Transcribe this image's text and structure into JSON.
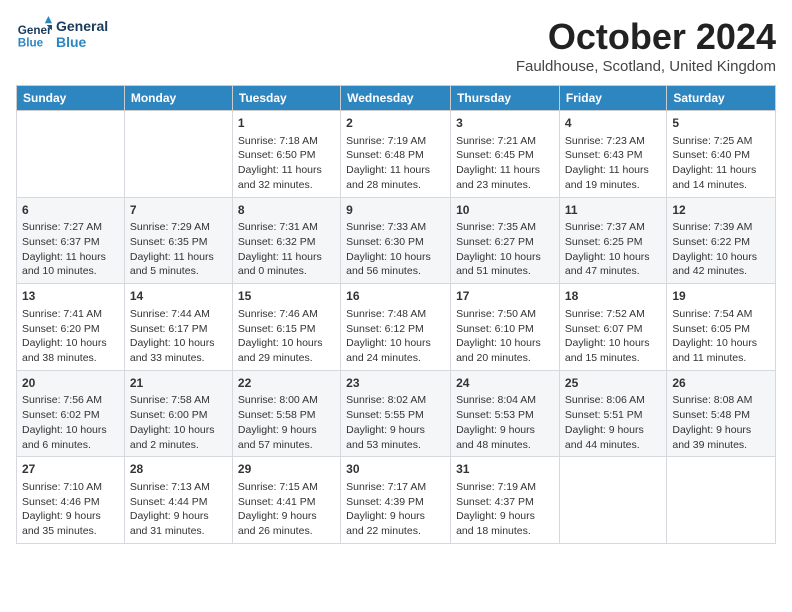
{
  "header": {
    "logo_line1": "General",
    "logo_line2": "Blue",
    "month_title": "October 2024",
    "location": "Fauldhouse, Scotland, United Kingdom"
  },
  "weekdays": [
    "Sunday",
    "Monday",
    "Tuesday",
    "Wednesday",
    "Thursday",
    "Friday",
    "Saturday"
  ],
  "weeks": [
    [
      {
        "day": "",
        "content": ""
      },
      {
        "day": "",
        "content": ""
      },
      {
        "day": "1",
        "content": "Sunrise: 7:18 AM\nSunset: 6:50 PM\nDaylight: 11 hours\nand 32 minutes."
      },
      {
        "day": "2",
        "content": "Sunrise: 7:19 AM\nSunset: 6:48 PM\nDaylight: 11 hours\nand 28 minutes."
      },
      {
        "day": "3",
        "content": "Sunrise: 7:21 AM\nSunset: 6:45 PM\nDaylight: 11 hours\nand 23 minutes."
      },
      {
        "day": "4",
        "content": "Sunrise: 7:23 AM\nSunset: 6:43 PM\nDaylight: 11 hours\nand 19 minutes."
      },
      {
        "day": "5",
        "content": "Sunrise: 7:25 AM\nSunset: 6:40 PM\nDaylight: 11 hours\nand 14 minutes."
      }
    ],
    [
      {
        "day": "6",
        "content": "Sunrise: 7:27 AM\nSunset: 6:37 PM\nDaylight: 11 hours\nand 10 minutes."
      },
      {
        "day": "7",
        "content": "Sunrise: 7:29 AM\nSunset: 6:35 PM\nDaylight: 11 hours\nand 5 minutes."
      },
      {
        "day": "8",
        "content": "Sunrise: 7:31 AM\nSunset: 6:32 PM\nDaylight: 11 hours\nand 0 minutes."
      },
      {
        "day": "9",
        "content": "Sunrise: 7:33 AM\nSunset: 6:30 PM\nDaylight: 10 hours\nand 56 minutes."
      },
      {
        "day": "10",
        "content": "Sunrise: 7:35 AM\nSunset: 6:27 PM\nDaylight: 10 hours\nand 51 minutes."
      },
      {
        "day": "11",
        "content": "Sunrise: 7:37 AM\nSunset: 6:25 PM\nDaylight: 10 hours\nand 47 minutes."
      },
      {
        "day": "12",
        "content": "Sunrise: 7:39 AM\nSunset: 6:22 PM\nDaylight: 10 hours\nand 42 minutes."
      }
    ],
    [
      {
        "day": "13",
        "content": "Sunrise: 7:41 AM\nSunset: 6:20 PM\nDaylight: 10 hours\nand 38 minutes."
      },
      {
        "day": "14",
        "content": "Sunrise: 7:44 AM\nSunset: 6:17 PM\nDaylight: 10 hours\nand 33 minutes."
      },
      {
        "day": "15",
        "content": "Sunrise: 7:46 AM\nSunset: 6:15 PM\nDaylight: 10 hours\nand 29 minutes."
      },
      {
        "day": "16",
        "content": "Sunrise: 7:48 AM\nSunset: 6:12 PM\nDaylight: 10 hours\nand 24 minutes."
      },
      {
        "day": "17",
        "content": "Sunrise: 7:50 AM\nSunset: 6:10 PM\nDaylight: 10 hours\nand 20 minutes."
      },
      {
        "day": "18",
        "content": "Sunrise: 7:52 AM\nSunset: 6:07 PM\nDaylight: 10 hours\nand 15 minutes."
      },
      {
        "day": "19",
        "content": "Sunrise: 7:54 AM\nSunset: 6:05 PM\nDaylight: 10 hours\nand 11 minutes."
      }
    ],
    [
      {
        "day": "20",
        "content": "Sunrise: 7:56 AM\nSunset: 6:02 PM\nDaylight: 10 hours\nand 6 minutes."
      },
      {
        "day": "21",
        "content": "Sunrise: 7:58 AM\nSunset: 6:00 PM\nDaylight: 10 hours\nand 2 minutes."
      },
      {
        "day": "22",
        "content": "Sunrise: 8:00 AM\nSunset: 5:58 PM\nDaylight: 9 hours\nand 57 minutes."
      },
      {
        "day": "23",
        "content": "Sunrise: 8:02 AM\nSunset: 5:55 PM\nDaylight: 9 hours\nand 53 minutes."
      },
      {
        "day": "24",
        "content": "Sunrise: 8:04 AM\nSunset: 5:53 PM\nDaylight: 9 hours\nand 48 minutes."
      },
      {
        "day": "25",
        "content": "Sunrise: 8:06 AM\nSunset: 5:51 PM\nDaylight: 9 hours\nand 44 minutes."
      },
      {
        "day": "26",
        "content": "Sunrise: 8:08 AM\nSunset: 5:48 PM\nDaylight: 9 hours\nand 39 minutes."
      }
    ],
    [
      {
        "day": "27",
        "content": "Sunrise: 7:10 AM\nSunset: 4:46 PM\nDaylight: 9 hours\nand 35 minutes."
      },
      {
        "day": "28",
        "content": "Sunrise: 7:13 AM\nSunset: 4:44 PM\nDaylight: 9 hours\nand 31 minutes."
      },
      {
        "day": "29",
        "content": "Sunrise: 7:15 AM\nSunset: 4:41 PM\nDaylight: 9 hours\nand 26 minutes."
      },
      {
        "day": "30",
        "content": "Sunrise: 7:17 AM\nSunset: 4:39 PM\nDaylight: 9 hours\nand 22 minutes."
      },
      {
        "day": "31",
        "content": "Sunrise: 7:19 AM\nSunset: 4:37 PM\nDaylight: 9 hours\nand 18 minutes."
      },
      {
        "day": "",
        "content": ""
      },
      {
        "day": "",
        "content": ""
      }
    ]
  ]
}
